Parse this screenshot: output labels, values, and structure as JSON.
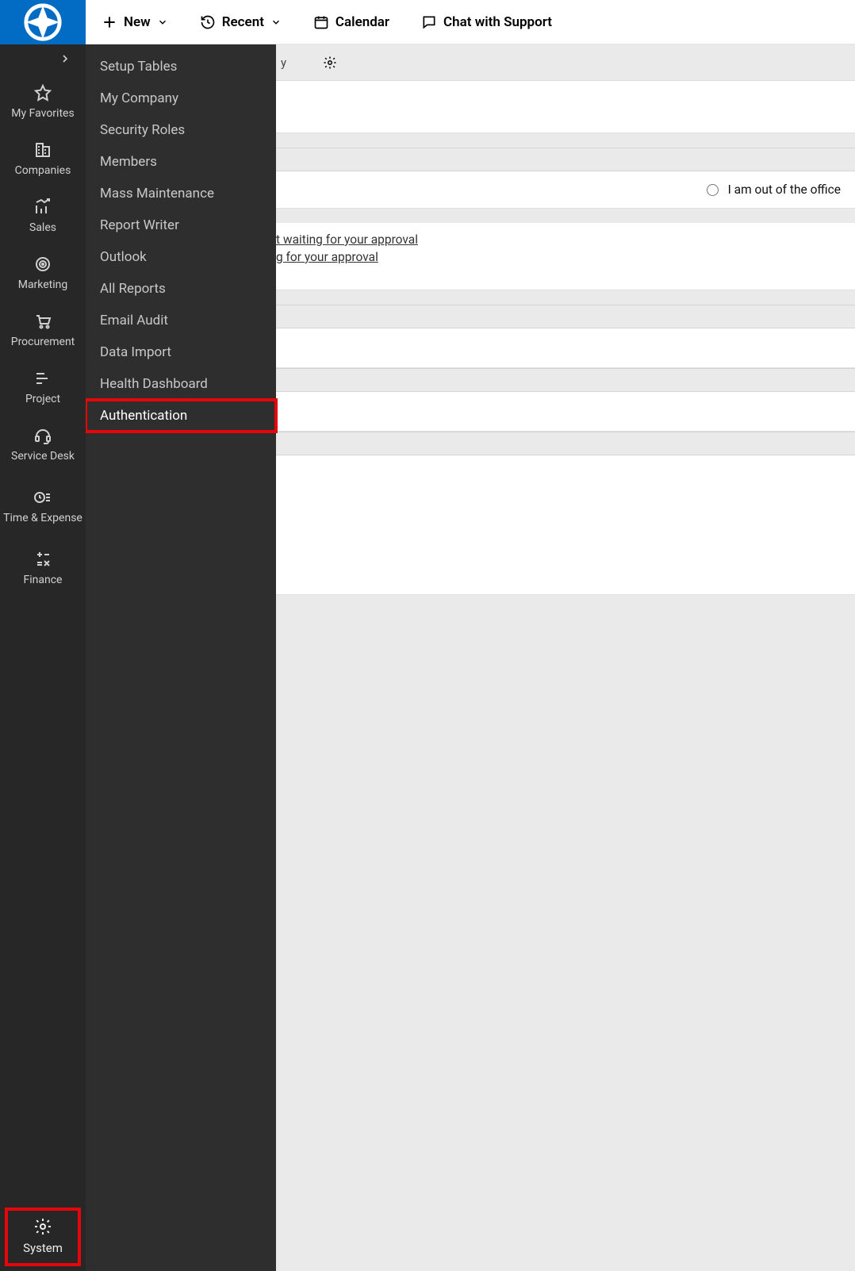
{
  "topbar": {
    "new_label": "New",
    "recent_label": "Recent",
    "calendar_label": "Calendar",
    "chat_label": "Chat with Support"
  },
  "rail": {
    "items": [
      {
        "label": "My Favorites",
        "icon": "star"
      },
      {
        "label": "Companies",
        "icon": "building"
      },
      {
        "label": "Sales",
        "icon": "chart"
      },
      {
        "label": "Marketing",
        "icon": "target"
      },
      {
        "label": "Procurement",
        "icon": "cart"
      },
      {
        "label": "Project",
        "icon": "gantt"
      },
      {
        "label": "Service Desk",
        "icon": "headset"
      },
      {
        "label": "Time & Expense",
        "icon": "clock-list"
      },
      {
        "label": "Finance",
        "icon": "calc"
      }
    ],
    "system_label": "System"
  },
  "submenu": {
    "items": [
      "Setup Tables",
      "My Company",
      "Security Roles",
      "Members",
      "Mass Maintenance",
      "Report Writer",
      "Outlook",
      "All Reports",
      "Email Audit",
      "Data Import",
      "Health Dashboard",
      "Authentication"
    ],
    "highlight_index": 11
  },
  "content": {
    "tab_fragment": "y",
    "out_of_office_label": "I am out of the office",
    "link1_fragment": "t waiting for your approval",
    "link2_fragment": "g for your approval"
  }
}
